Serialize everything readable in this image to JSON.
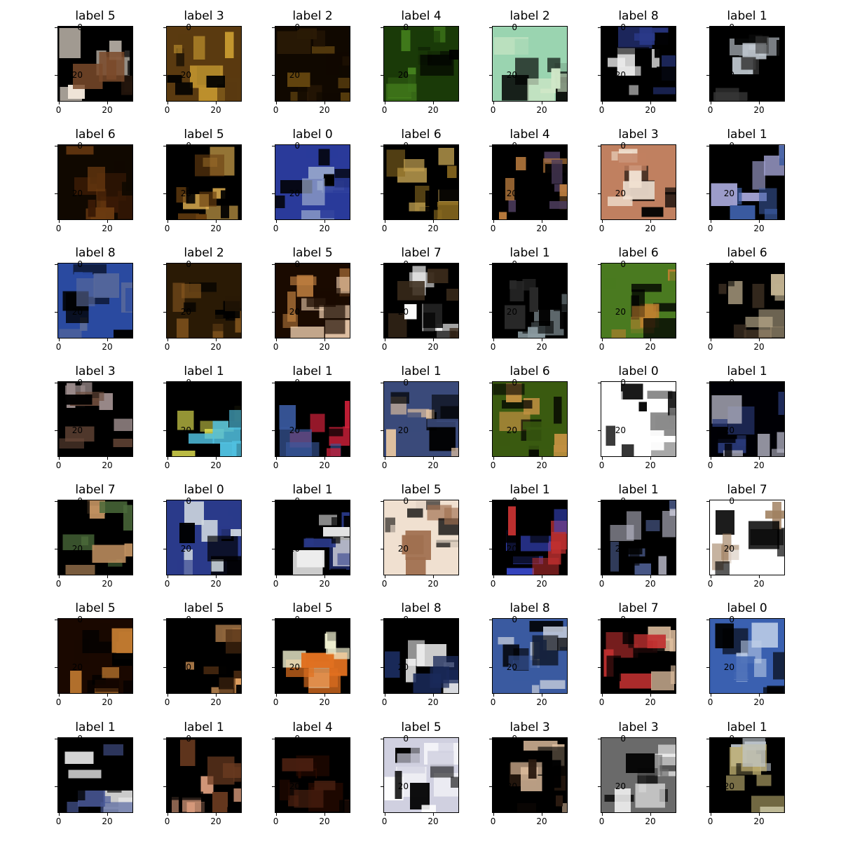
{
  "figure": {
    "ticks": {
      "y": [
        "0",
        "20"
      ],
      "x": [
        "0",
        "20"
      ]
    },
    "panels": [
      {
        "title": "label 5"
      },
      {
        "title": "label 3"
      },
      {
        "title": "label 2"
      },
      {
        "title": "label 4"
      },
      {
        "title": "label 2"
      },
      {
        "title": "label 8"
      },
      {
        "title": "label 1"
      },
      {
        "title": "label 6"
      },
      {
        "title": "label 5"
      },
      {
        "title": "label 0"
      },
      {
        "title": "label 6"
      },
      {
        "title": "label 4"
      },
      {
        "title": "label 3"
      },
      {
        "title": "label 1"
      },
      {
        "title": "label 8"
      },
      {
        "title": "label 2"
      },
      {
        "title": "label 5"
      },
      {
        "title": "label 7"
      },
      {
        "title": "label 1"
      },
      {
        "title": "label 6"
      },
      {
        "title": "label 6"
      },
      {
        "title": "label 3"
      },
      {
        "title": "label 1"
      },
      {
        "title": "label 1"
      },
      {
        "title": "label 1"
      },
      {
        "title": "label 6"
      },
      {
        "title": "label 0"
      },
      {
        "title": "label 1"
      },
      {
        "title": "label 7"
      },
      {
        "title": "label 0"
      },
      {
        "title": "label 1"
      },
      {
        "title": "label 5"
      },
      {
        "title": "label 1"
      },
      {
        "title": "label 1"
      },
      {
        "title": "label 7"
      },
      {
        "title": "label 5"
      },
      {
        "title": "label 5"
      },
      {
        "title": "label 5"
      },
      {
        "title": "label 8"
      },
      {
        "title": "label 8"
      },
      {
        "title": "label 7"
      },
      {
        "title": "label 0"
      },
      {
        "title": "label 1"
      },
      {
        "title": "label 1"
      },
      {
        "title": "label 4"
      },
      {
        "title": "label 5"
      },
      {
        "title": "label 3"
      },
      {
        "title": "label 3"
      },
      {
        "title": "label 1"
      }
    ],
    "palette": [
      {
        "bg": "#000000",
        "c1": "#f0e6d8",
        "c2": "#7a4a2a"
      },
      {
        "bg": "#5a3a10",
        "c1": "#c89a30",
        "c2": "#000000"
      },
      {
        "bg": "#100800",
        "c1": "#6a4a10",
        "c2": "#2a1a05"
      },
      {
        "bg": "#1a3a08",
        "c1": "#4a8a20",
        "c2": "#000000"
      },
      {
        "bg": "#9ad4b0",
        "c1": "#000000",
        "c2": "#d0e8c8"
      },
      {
        "bg": "#000000",
        "c1": "#f0f0f0",
        "c2": "#2a3a8a"
      },
      {
        "bg": "#000000",
        "c1": "#c0c8d0",
        "c2": "#3a3a3a"
      },
      {
        "bg": "#100800",
        "c1": "#6a3a10",
        "c2": "#3a1a05"
      },
      {
        "bg": "#000000",
        "c1": "#e0b050",
        "c2": "#6a4010"
      },
      {
        "bg": "#2a3a9a",
        "c1": "#000000",
        "c2": "#a0b0d0"
      },
      {
        "bg": "#000000",
        "c1": "#8a6a20",
        "c2": "#c0a050"
      },
      {
        "bg": "#000000",
        "c1": "#4a3a5a",
        "c2": "#c08040"
      },
      {
        "bg": "#c08060",
        "c1": "#000000",
        "c2": "#f0e0d0"
      },
      {
        "bg": "#000000",
        "c1": "#a0a0d0",
        "c2": "#3a5aa0"
      },
      {
        "bg": "#2a4aa0",
        "c1": "#000000",
        "c2": "#5a6a9a"
      },
      {
        "bg": "#2a1a05",
        "c1": "#8a5a20",
        "c2": "#000000"
      },
      {
        "bg": "#1a0a00",
        "c1": "#c08040",
        "c2": "#f0d0b0"
      },
      {
        "bg": "#000000",
        "c1": "#ffffff",
        "c2": "#3a2a1a"
      },
      {
        "bg": "#000000",
        "c1": "#8a9aa0",
        "c2": "#2a2a2a"
      },
      {
        "bg": "#4a7a20",
        "c1": "#000000",
        "c2": "#c08030"
      },
      {
        "bg": "#000000",
        "c1": "#c0b090",
        "c2": "#4a3a2a"
      },
      {
        "bg": "#000000",
        "c1": "#9a8a8a",
        "c2": "#6a4a3a"
      },
      {
        "bg": "#000000",
        "c1": "#50c0e0",
        "c2": "#e0e050"
      },
      {
        "bg": "#000000",
        "c1": "#d0203a",
        "c2": "#3a5aa0"
      },
      {
        "bg": "#3a4a7a",
        "c1": "#000000",
        "c2": "#e0c0a0"
      },
      {
        "bg": "#3a5a10",
        "c1": "#c09040",
        "c2": "#000000"
      },
      {
        "bg": "#ffffff",
        "c1": "#000000",
        "c2": "#8a8a8a"
      },
      {
        "bg": "#000005",
        "c1": "#2a3a7a",
        "c2": "#b0b0c0"
      },
      {
        "bg": "#000000",
        "c1": "#c09060",
        "c2": "#4a6a3a"
      },
      {
        "bg": "#2a3a8a",
        "c1": "#000000",
        "c2": "#d0d8e0"
      },
      {
        "bg": "#000000",
        "c1": "#f0f0f0",
        "c2": "#2a3a8a"
      },
      {
        "bg": "#f0e0d0",
        "c1": "#000000",
        "c2": "#a07050"
      },
      {
        "bg": "#000000",
        "c1": "#3a4ad0",
        "c2": "#c03030"
      },
      {
        "bg": "#000000",
        "c1": "#4a5a8a",
        "c2": "#c0c0d0"
      },
      {
        "bg": "#ffffff",
        "c1": "#000000",
        "c2": "#a08060"
      },
      {
        "bg": "#1a0800",
        "c1": "#c07a30",
        "c2": "#000000"
      },
      {
        "bg": "#000000",
        "c1": "#e0a060",
        "c2": "#4a2a10"
      },
      {
        "bg": "#000000",
        "c1": "#e07020",
        "c2": "#f0f0d0"
      },
      {
        "bg": "#000000",
        "c1": "#ffffff",
        "c2": "#1a2a5a"
      },
      {
        "bg": "#3a5aa0",
        "c1": "#000000",
        "c2": "#c0c8d8"
      },
      {
        "bg": "#000000",
        "c1": "#e0c0a0",
        "c2": "#c03030"
      },
      {
        "bg": "#3a60b0",
        "c1": "#000000",
        "c2": "#c0d0e8"
      },
      {
        "bg": "#000000",
        "c1": "#e0e0e0",
        "c2": "#4a5a9a"
      },
      {
        "bg": "#000000",
        "c1": "#e0a080",
        "c2": "#6a3a20"
      },
      {
        "bg": "#000000",
        "c1": "#2a0a00",
        "c2": "#4a2010"
      },
      {
        "bg": "#d0d0e0",
        "c1": "#000000",
        "c2": "#ffffff"
      },
      {
        "bg": "#000000",
        "c1": "#e0c0a0",
        "c2": "#2a1a10"
      },
      {
        "bg": "#6a6a6a",
        "c1": "#000000",
        "c2": "#ffffff"
      },
      {
        "bg": "#000000",
        "c1": "#c0b070",
        "c2": "#c0c8d0"
      }
    ]
  }
}
